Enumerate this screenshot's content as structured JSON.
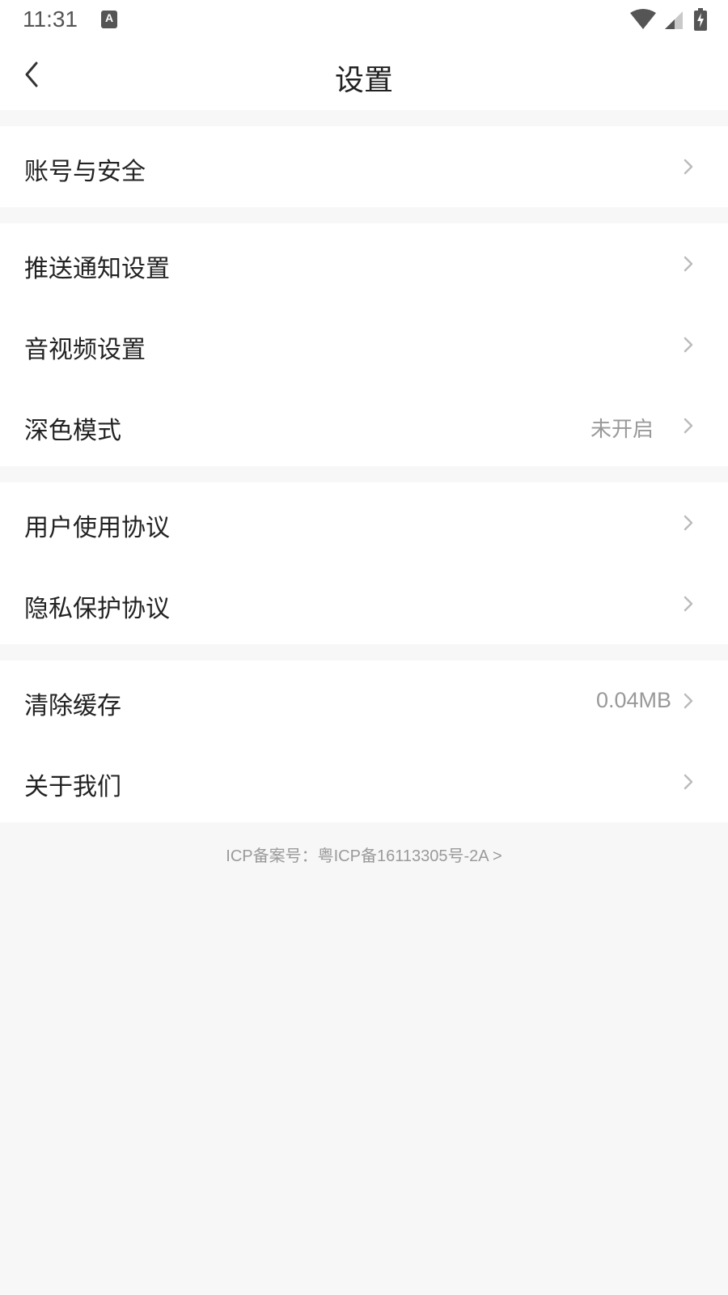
{
  "status_bar": {
    "time": "11:31",
    "notification_icon": "a-keyboard-icon",
    "notification_glyph": "A",
    "wifi_icon": "wifi-icon",
    "signal_icon": "signal-icon",
    "battery_icon": "battery-charging-icon"
  },
  "header": {
    "back_icon": "chevron-left-icon",
    "title": "设置"
  },
  "groups": [
    {
      "items": [
        {
          "label": "账号与安全",
          "value": ""
        }
      ]
    },
    {
      "items": [
        {
          "label": "推送通知设置",
          "value": ""
        },
        {
          "label": "音视频设置",
          "value": ""
        },
        {
          "label": "深色模式",
          "value": "未开启"
        }
      ]
    },
    {
      "items": [
        {
          "label": "用户使用协议",
          "value": ""
        },
        {
          "label": "隐私保护协议",
          "value": ""
        }
      ]
    },
    {
      "items": [
        {
          "label": "清除缓存",
          "value": "0.04MB"
        },
        {
          "label": "关于我们",
          "value": ""
        }
      ]
    }
  ],
  "footer": {
    "icp": "ICP备案号：粤ICP备16113305号-2A >"
  },
  "colors": {
    "background": "#f7f7f7",
    "surface": "#ffffff",
    "text_primary": "#222222",
    "text_secondary": "#999999",
    "chevron": "#bbbbbb"
  }
}
